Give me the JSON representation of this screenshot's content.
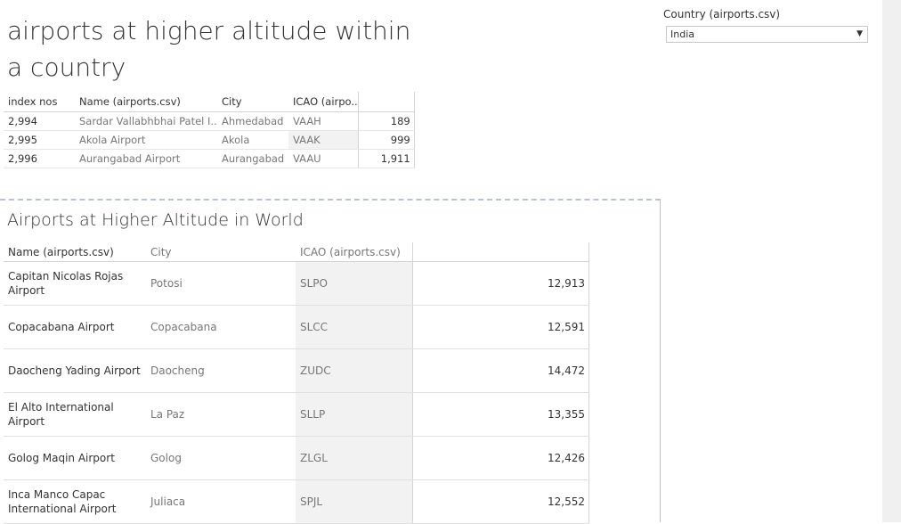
{
  "dashboard": {
    "title": "airports at higher altitude within a country",
    "filter": {
      "label": "Country (airports.csv)",
      "selected": "India"
    }
  },
  "table1": {
    "headers": [
      "index nos",
      "Name (airports.csv)",
      "City",
      "ICAO (airpo..",
      ""
    ],
    "rows": [
      {
        "idx": "2,994",
        "name": "Sardar Vallabhbhai Patel I..",
        "city": "Ahmedabad",
        "icao": "VAAH",
        "alt": "189"
      },
      {
        "idx": "2,995",
        "name": "Akola Airport",
        "city": "Akola",
        "icao": "VAAK",
        "alt": "999"
      },
      {
        "idx": "2,996",
        "name": "Aurangabad Airport",
        "city": "Aurangabad",
        "icao": "VAAU",
        "alt": "1,911"
      }
    ]
  },
  "table2": {
    "title": "Airports at Higher Altitude in World",
    "headers": [
      "Name (airports.csv)",
      "City",
      "ICAO (airports.csv)",
      ""
    ],
    "rows": [
      {
        "name": "Capitan Nicolas Rojas Airport",
        "city": "Potosi",
        "icao": "SLPO",
        "alt": "12,913"
      },
      {
        "name": "Copacabana Airport",
        "city": "Copacabana",
        "icao": "SLCC",
        "alt": "12,591"
      },
      {
        "name": "Daocheng Yading Airport",
        "city": "Daocheng",
        "icao": "ZUDC",
        "alt": "14,472"
      },
      {
        "name": "El Alto International Airport",
        "city": "La Paz",
        "icao": "SLLP",
        "alt": "13,355"
      },
      {
        "name": "Golog Maqin Airport",
        "city": "Golog",
        "icao": "ZLGL",
        "alt": "12,426"
      },
      {
        "name": "Inca Manco Capac International Airport",
        "city": "Juliaca",
        "icao": "SPJL",
        "alt": "12,552"
      }
    ]
  },
  "icons": {
    "dropdown": "chevron-down-icon"
  }
}
